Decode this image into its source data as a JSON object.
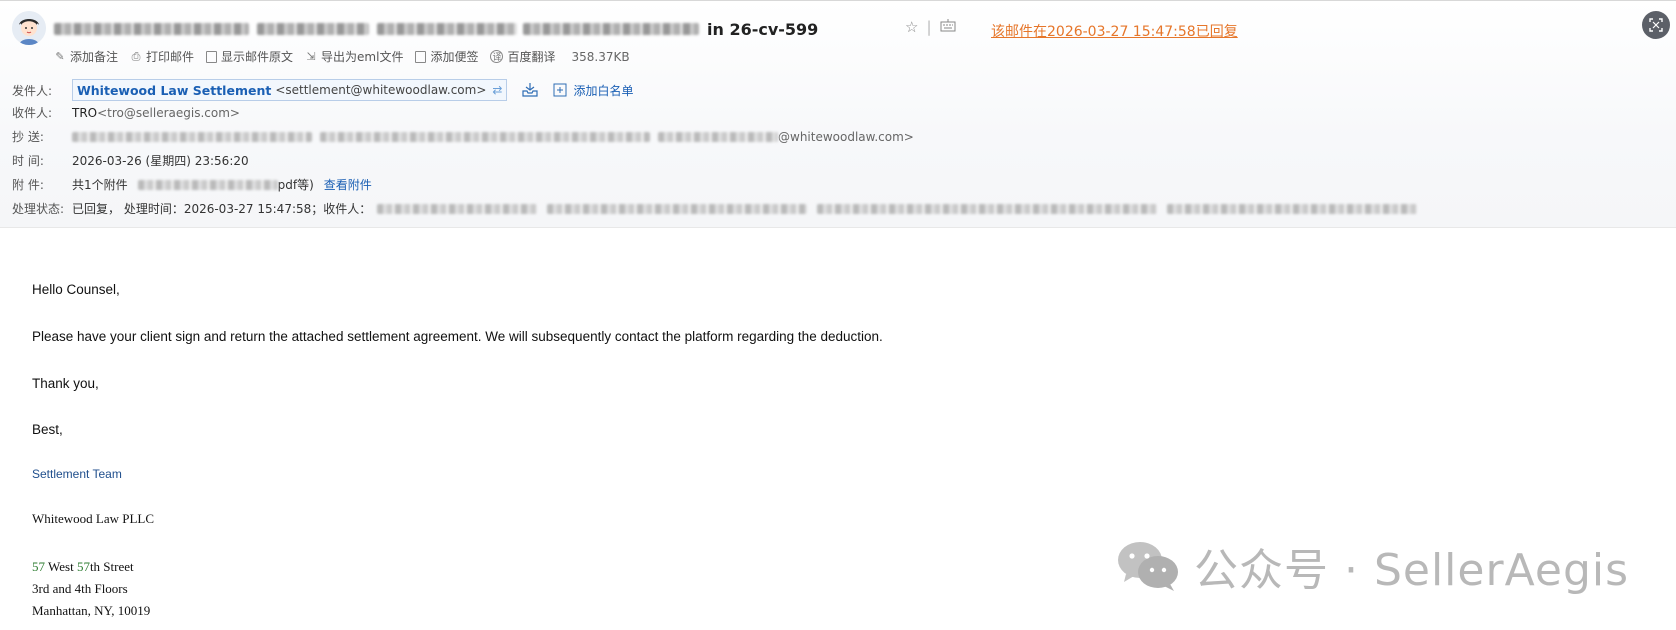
{
  "subject": {
    "suffix": "in 26-cv-599"
  },
  "replied_notice": "该邮件在2026-03-27 15:47:58已回复",
  "toolbar": {
    "add_note": "添加备注",
    "print": "打印邮件",
    "show_source": "显示邮件原文",
    "export_eml": "导出为eml文件",
    "add_sticky": "添加便签",
    "translate": "百度翻译",
    "size": "358.37KB"
  },
  "headers": {
    "from_label": "发件人:",
    "from_name": "Whitewood Law Settlement",
    "from_email": "<settlement@whitewoodlaw.com>",
    "add_whitelist": "添加白名单",
    "to_label": "收件人:",
    "to_name": "TRO",
    "to_email": "<tro@selleraegis.com>",
    "cc_label": "抄 送:",
    "cc_visible_tail": "@whitewoodlaw.com>",
    "time_label": "时 间:",
    "time_value": "2026-03-26 (星期四) 23:56:20",
    "attach_label": "附 件:",
    "attach_count": "共1个附件",
    "attach_suffix": "pdf等)",
    "view_attach": "查看附件",
    "status_label": "处理状态:",
    "status_value": "已回复， 处理时间：2026-03-27 15:47:58；收件人："
  },
  "body": {
    "greeting": "Hello Counsel,",
    "para1": "Please have your client sign and return the attached settlement agreement. We will subsequently contact the platform regarding the deduction.",
    "thanks": "Thank you,",
    "best": "Best,",
    "team": "Settlement Team",
    "firm": "Whitewood Law PLLC",
    "addr1_num1": "57",
    "addr1_mid": " West ",
    "addr1_num2": "57",
    "addr1_end": "th Street",
    "addr2": "3rd and 4th Floors",
    "addr3": "Manhattan, NY, 10019"
  },
  "watermark": "公众号 · SellerAegis",
  "colors": {
    "accent_orange": "#e6762a",
    "link_blue": "#1a5fb4",
    "sig_blue": "#1f4e8c",
    "address_green": "#2e7d32"
  }
}
